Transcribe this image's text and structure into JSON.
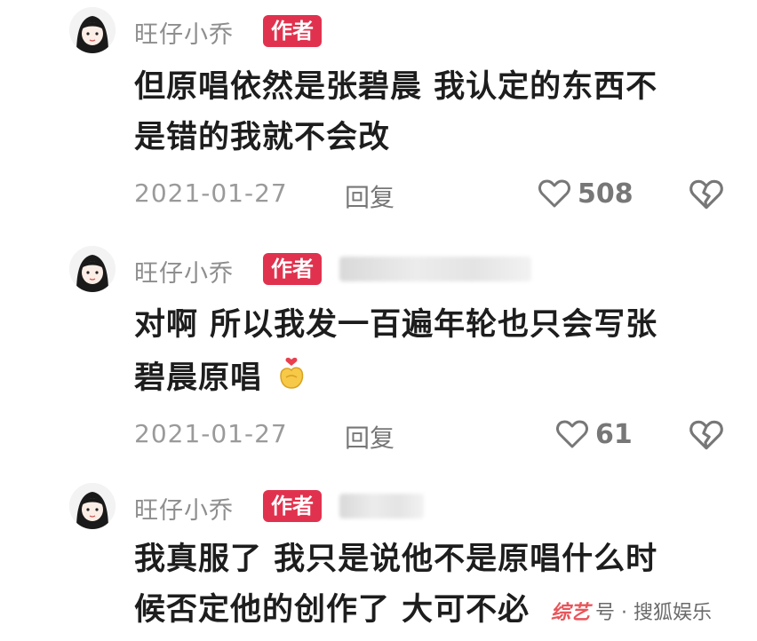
{
  "comments": [
    {
      "username": "旺仔小乔",
      "badge": "作者",
      "text_line1": "但原唱依然是张碧晨 我认定的东西不",
      "text_line2": "是错的我就不会改",
      "date": "2021-01-27",
      "reply": "回复",
      "likes": "508",
      "icons": [
        "heart-outline-icon",
        "broken-heart-icon"
      ]
    },
    {
      "username": "旺仔小乔",
      "badge": "作者",
      "text_line1": "对啊 所以我发一百遍年轮也只会写张",
      "text_line2": "碧晨原唱",
      "emoji": "finger-heart-emoji",
      "date": "2021-01-27",
      "reply": "回复",
      "likes": "61",
      "icons": [
        "heart-outline-icon",
        "broken-heart-icon"
      ]
    },
    {
      "username": "旺仔小乔",
      "badge": "作者",
      "text_line1": "我真服了 我只是说他不是原唱什么时",
      "text_line2": "候否定他的创作了 大可不必"
    }
  ],
  "watermark": {
    "logo_text": "综艺",
    "text": "号 · 搜狐娱乐"
  },
  "colors": {
    "badge": "#e0324e",
    "username": "#8e8e8e",
    "body": "#1d1d1d",
    "meta": "#9a9a9a"
  }
}
